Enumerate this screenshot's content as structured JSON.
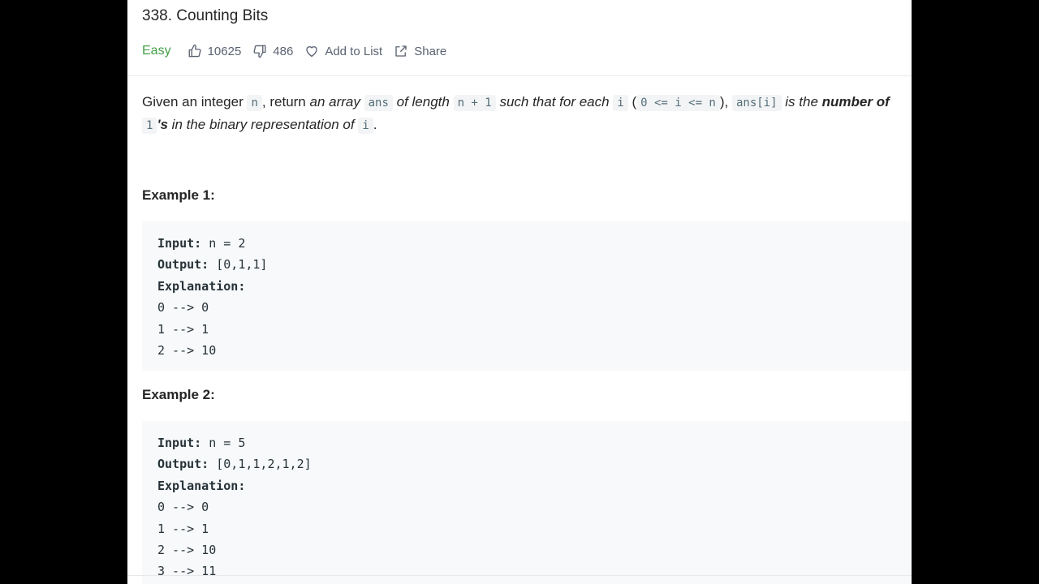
{
  "problem": {
    "title": "338. Counting Bits",
    "difficulty": "Easy",
    "likes": "10625",
    "dislikes": "486",
    "add_to_list_label": "Add to List",
    "share_label": "Share"
  },
  "description": {
    "t1": "Given an integer ",
    "c1": "n",
    "t2": ", return ",
    "e1": "an array ",
    "c2": "ans",
    "e2": " of length ",
    "c3": "n + 1",
    "e3": " such that for each ",
    "c4": "i",
    "t3": " (",
    "c5": "0 <= i <= n",
    "t4": "), ",
    "c6": "ans[i]",
    "e4": " is the ",
    "s1": "number of ",
    "c7": "1",
    "s2": "'s",
    "e5": " in the binary representation of ",
    "c8": "i",
    "t5": "."
  },
  "examples": [
    {
      "title": "Example 1:",
      "input_label": "Input:",
      "input": " n = 2",
      "output_label": "Output:",
      "output": " [0,1,1]",
      "explanation_label": "Explanation:",
      "lines": [
        "0 --> 0",
        "1 --> 1",
        "2 --> 10"
      ]
    },
    {
      "title": "Example 2:",
      "input_label": "Input:",
      "input": " n = 5",
      "output_label": "Output:",
      "output": " [0,1,1,2,1,2]",
      "explanation_label": "Explanation:",
      "lines": [
        "0 --> 0",
        "1 --> 1",
        "2 --> 10",
        "3 --> 11"
      ]
    }
  ],
  "icons": {
    "like": "thumbs-up-icon",
    "dislike": "thumbs-down-icon",
    "add_to_list": "heart-icon",
    "share": "share-icon"
  },
  "colors": {
    "difficulty_easy": "#43a047",
    "code_bg": "#f7f9fa"
  }
}
